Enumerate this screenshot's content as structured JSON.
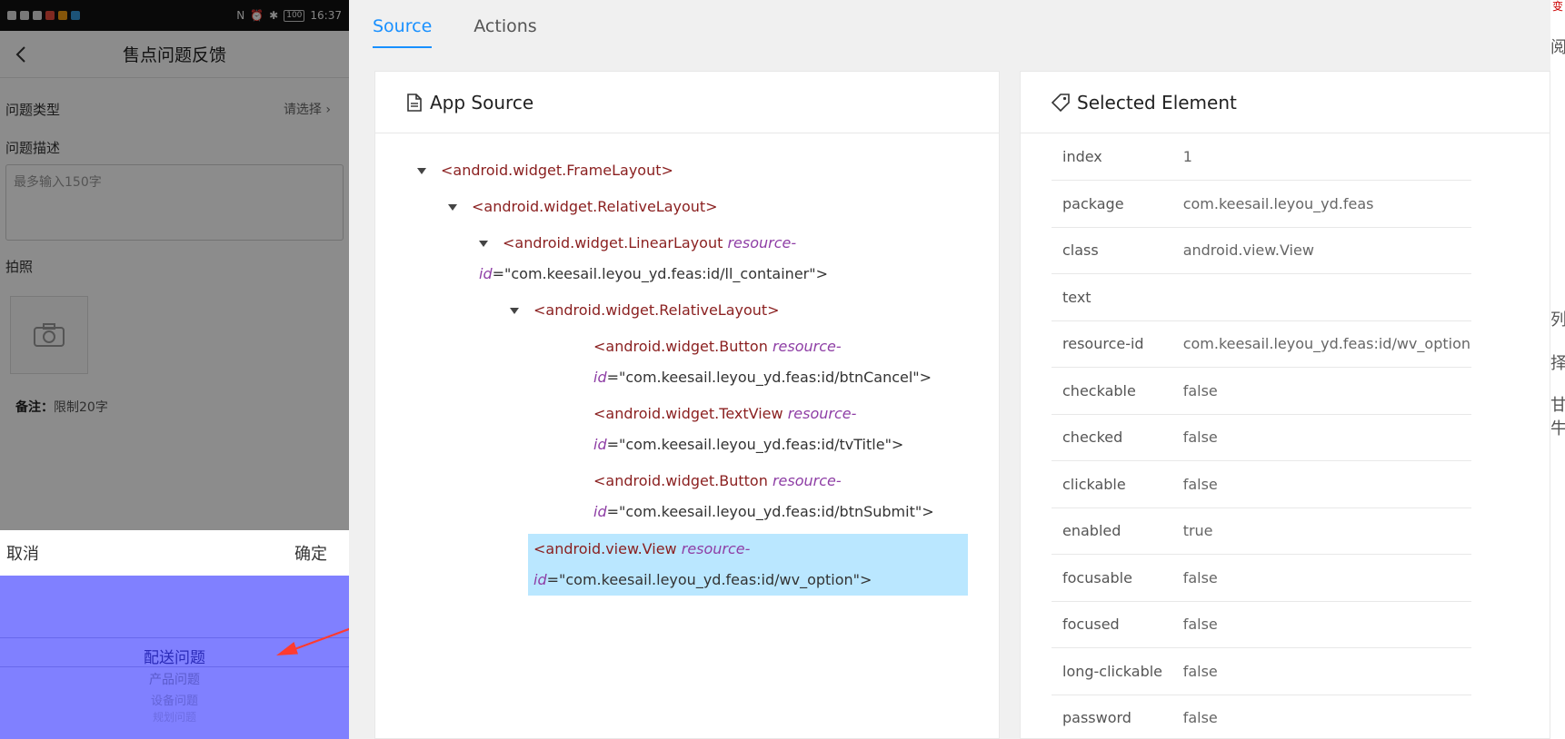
{
  "phone": {
    "status": {
      "time": "16:37",
      "battery": "100"
    },
    "header_title": "售点问题反馈",
    "problem_type_label": "问题类型",
    "problem_type_value": "请选择",
    "desc_label": "问题描述",
    "desc_placeholder": "最多输入150字",
    "photo_label": "拍照",
    "note_bold": "备注：",
    "note_text": "限制20字",
    "cancel": "取消",
    "confirm": "确定",
    "options": [
      "配送问题",
      "产品问题",
      "设备问题",
      "规划问题"
    ],
    "colors": {
      "wheel": "#8080ff",
      "arrow": "#ff3b30"
    }
  },
  "inspector": {
    "tabs": [
      "Source",
      "Actions"
    ],
    "source_title": "App Source",
    "selected_title": "Selected Element",
    "tree": [
      {
        "open": "<android.widget.FrameLayout>"
      },
      {
        "open": "<android.widget.RelativeLayout>"
      },
      {
        "tag": "<android.widget.LinearLayout",
        "attr1": "resource-",
        "attr2": "id",
        "value": "=\"com.keesail.leyou_yd.feas:id/ll_container\">"
      },
      {
        "open": "<android.widget.RelativeLayout>"
      },
      {
        "tag": "<android.widget.Button",
        "attr1": "resource-",
        "attr2": "id",
        "value": "=\"com.keesail.leyou_yd.feas:id/btnCancel\">"
      },
      {
        "tag": "<android.widget.TextView",
        "attr1": "resource-",
        "attr2": "id",
        "value": "=\"com.keesail.leyou_yd.feas:id/tvTitle\">"
      },
      {
        "tag": "<android.widget.Button",
        "attr1": "resource-",
        "attr2": "id",
        "value": "=\"com.keesail.leyou_yd.feas:id/btnSubmit\">"
      },
      {
        "tag": "<android.view.View",
        "attr1": "resource-",
        "attr2": "id",
        "value": "=\"com.keesail.leyou_yd.feas:id/wv_option\">"
      }
    ],
    "props": [
      {
        "k": "index",
        "v": "1"
      },
      {
        "k": "package",
        "v": "com.keesail.leyou_yd.feas"
      },
      {
        "k": "class",
        "v": "android.view.View"
      },
      {
        "k": "text",
        "v": ""
      },
      {
        "k": "resource-id",
        "v": "com.keesail.leyou_yd.feas:id/wv_option"
      },
      {
        "k": "checkable",
        "v": "false"
      },
      {
        "k": "checked",
        "v": "false"
      },
      {
        "k": "clickable",
        "v": "false"
      },
      {
        "k": "enabled",
        "v": "true"
      },
      {
        "k": "focusable",
        "v": "false"
      },
      {
        "k": "focused",
        "v": "false"
      },
      {
        "k": "long-clickable",
        "v": "false"
      },
      {
        "k": "password",
        "v": "false"
      }
    ],
    "colors": {
      "accent": "#1890ff",
      "selected_bg": "#bae7ff"
    }
  },
  "edge_chars": [
    "变",
    "阅",
    "列",
    "择",
    "甘牛"
  ]
}
